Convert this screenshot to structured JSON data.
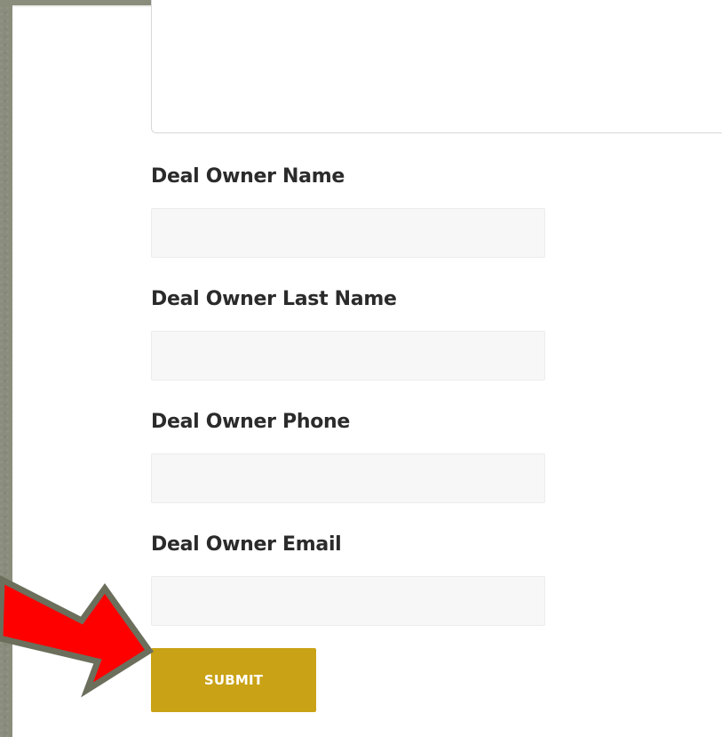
{
  "form": {
    "description_value": "",
    "fields": [
      {
        "label": "Deal Owner Name",
        "value": ""
      },
      {
        "label": "Deal Owner Last Name",
        "value": ""
      },
      {
        "label": "Deal Owner Phone",
        "value": ""
      },
      {
        "label": "Deal Owner Email",
        "value": ""
      }
    ],
    "submit_label": "SUBMIT"
  },
  "colors": {
    "submit_button": "#c9a215",
    "arrow_fill": "#ff0000",
    "arrow_outline": "#6b6f5c",
    "background": "#8a8d7c"
  },
  "annotation": {
    "icon": "red-arrow-icon"
  }
}
